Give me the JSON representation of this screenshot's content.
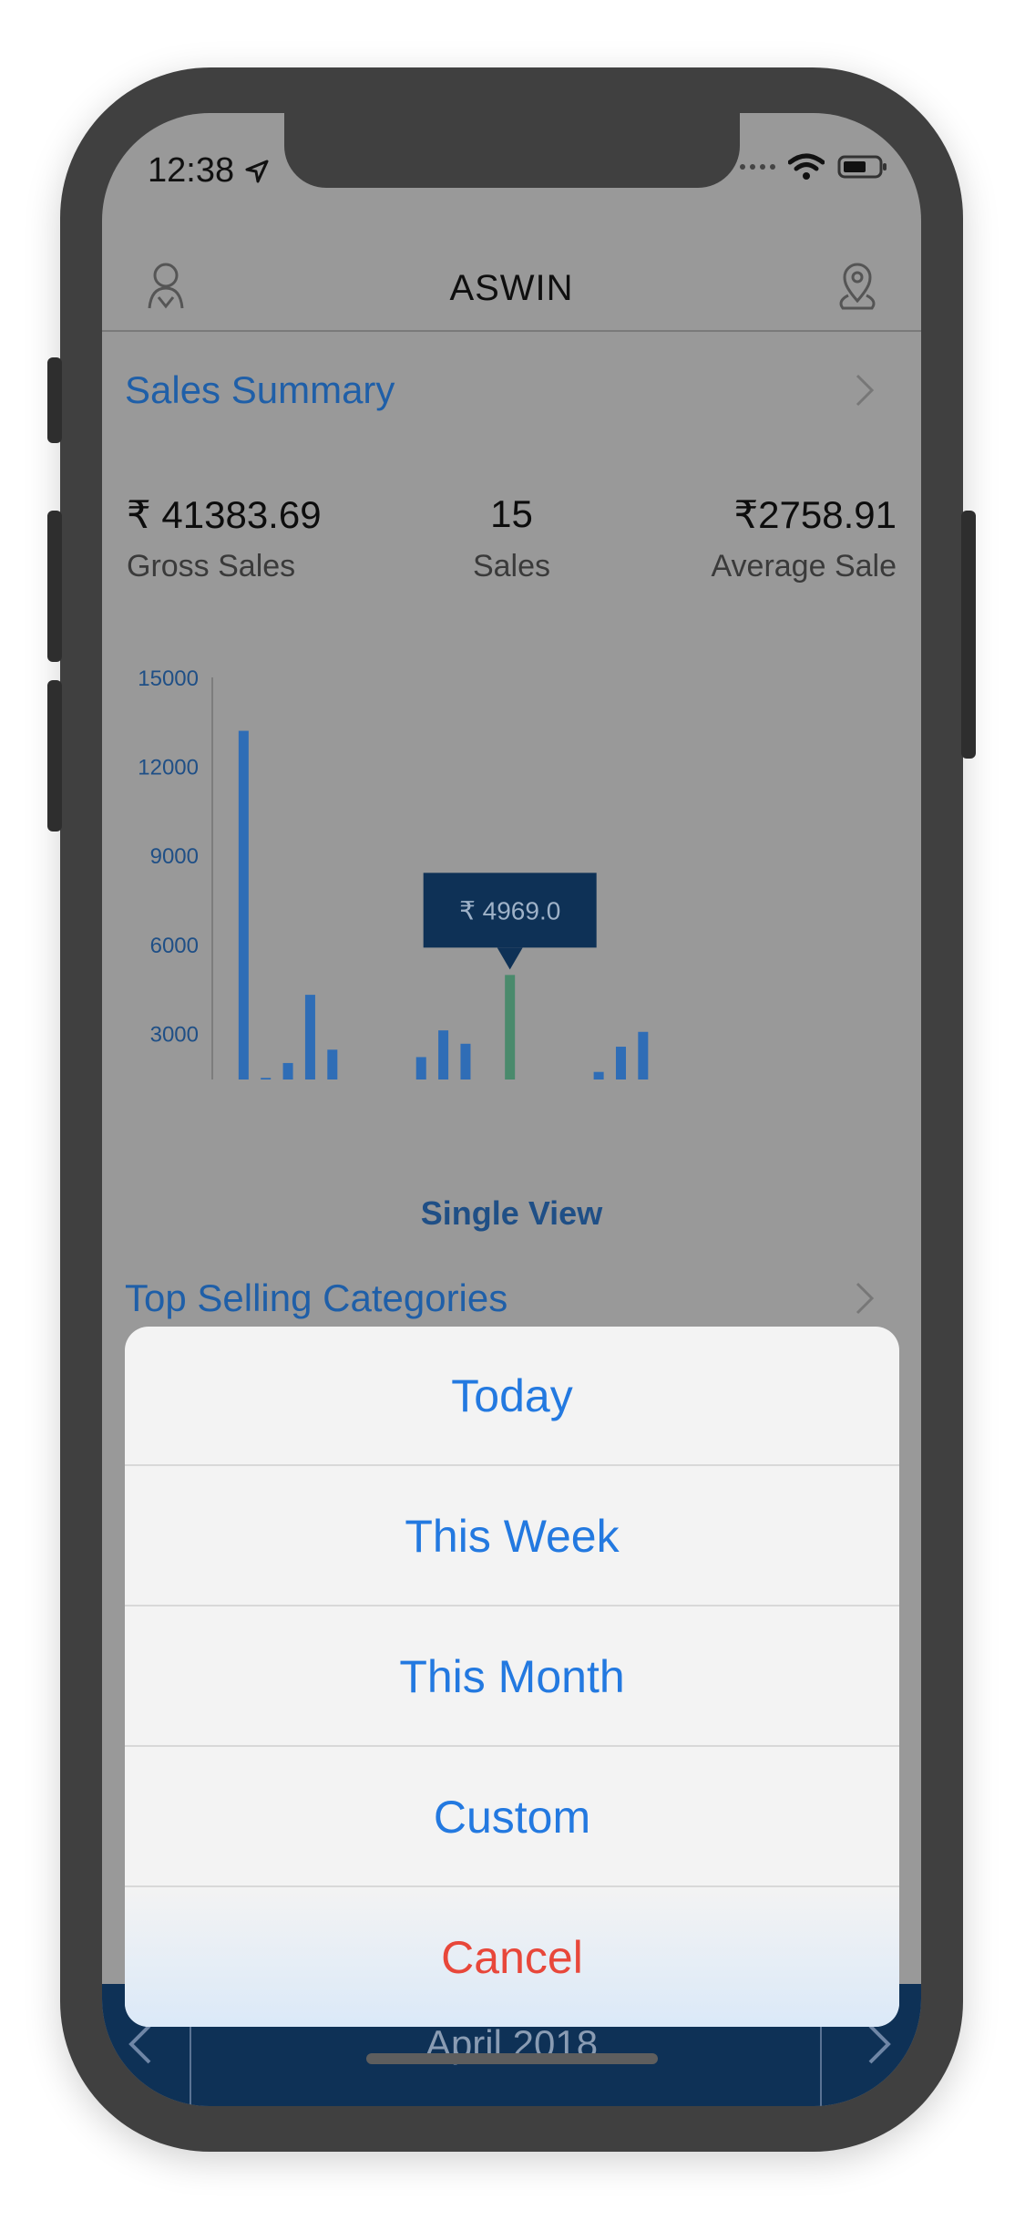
{
  "status_bar": {
    "time": "12:38"
  },
  "navbar": {
    "title": "ASWIN",
    "left_icon": "user-icon",
    "right_icon": "location-pin-icon"
  },
  "sales_summary": {
    "heading": "Sales Summary",
    "gross_sales_value": "₹ 41383.69",
    "gross_sales_label": "Gross Sales",
    "sales_count_value": "15",
    "sales_count_label": "Sales",
    "average_sale_value": "₹2758.91",
    "average_sale_label": "Average Sale"
  },
  "chart_data": {
    "type": "bar",
    "x": [
      2,
      3,
      4,
      5,
      6,
      10,
      11,
      12,
      13,
      14,
      17,
      18,
      19,
      20,
      21
    ],
    "values": [
      13200,
      1500,
      2000,
      4300,
      2450,
      2200,
      3100,
      2650,
      1250,
      4969,
      1300,
      1700,
      2550,
      3050,
      300
    ],
    "xticks": [
      "1",
      "6",
      "11",
      "16",
      "21",
      "26"
    ],
    "yticks": [
      "0",
      "3000",
      "6000",
      "9000",
      "12000",
      "15000"
    ],
    "xlim": [
      1,
      31
    ],
    "ylim": [
      0,
      15000
    ],
    "highlighted_x": 14,
    "tooltip": "₹ 4969.0",
    "bar_color": "#2f6db6",
    "highlight_color": "#4a8a6c"
  },
  "view_toggle_label": "Single View",
  "top_categories": {
    "heading": "Top Selling Categories"
  },
  "footer": {
    "month": "April 2018"
  },
  "action_sheet": {
    "options": [
      "Today",
      "This Week",
      "This Month",
      "Custom"
    ],
    "cancel": "Cancel"
  }
}
